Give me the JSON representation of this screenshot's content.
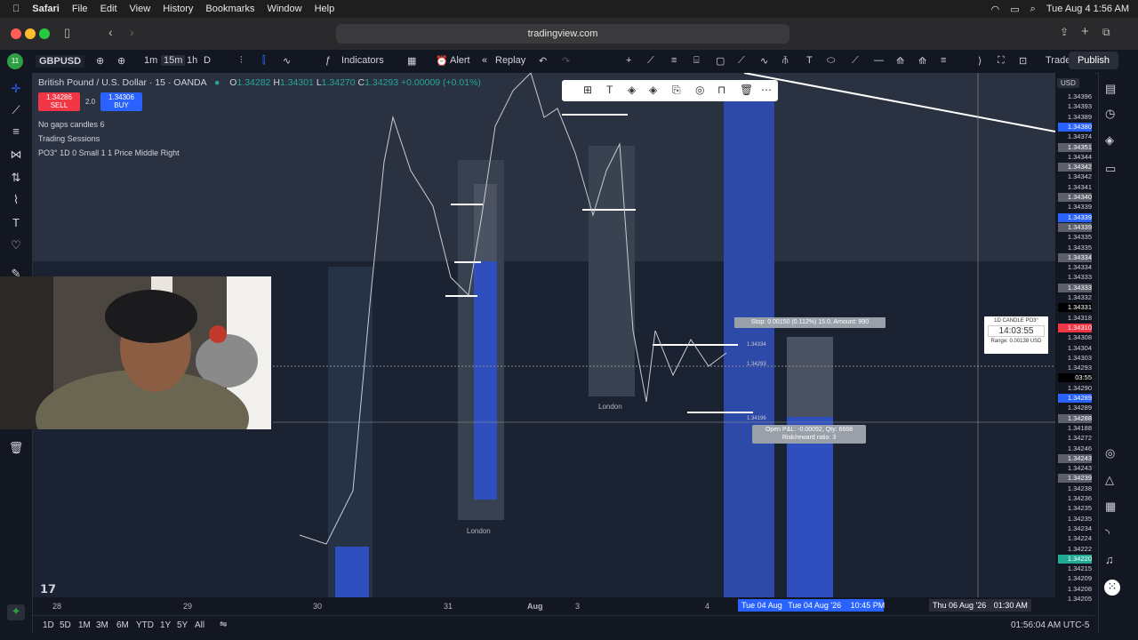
{
  "menubar": {
    "apple": "",
    "items": [
      "Safari",
      "File",
      "Edit",
      "View",
      "History",
      "Bookmarks",
      "Window",
      "Help"
    ],
    "clock": "Tue Aug 4  1:56 AM"
  },
  "browser": {
    "url": "tradingview.com"
  },
  "toolbar": {
    "badge": "11",
    "symbol": "GBPUSD",
    "intervals": [
      "1m",
      "15m",
      "1h",
      "D"
    ],
    "indicators": "Indicators",
    "alert": "Alert",
    "replay": "Replay",
    "trade": "Trade",
    "publish": "Publish"
  },
  "legend": {
    "title": "British Pound / U.S. Dollar · 15 · OANDA",
    "o_label": "O",
    "o": "1.34282",
    "h_label": "H",
    "h": "1.34301",
    "l_label": "L",
    "l": "1.34270",
    "c_label": "C",
    "c": "1.34293",
    "change": "+0.00009 (+0.01%)",
    "sell_price": "1.34286",
    "sell_label": "SELL",
    "spread": "2.0",
    "buy_price": "1.34306",
    "buy_label": "BUY",
    "indicators": [
      "No gaps candles 6",
      "Trading Sessions",
      "PO3° 1D 0 Small 1 1 Price Middle Right"
    ]
  },
  "chart": {
    "sessions": [
      "London",
      "London"
    ],
    "position": {
      "stop": "Stop: 0.00150 (0.112%) 15.0, Amount: 990",
      "pnl": "Open P&L: -0.00092, Qty: 6668",
      "rr": "Risk/reward ratio: 3",
      "entry": "1.34334",
      "entry2": "1.34293",
      "target": "1.34196"
    },
    "po3": {
      "title": "1D CANDLE PO3°",
      "timer": "14:03:55",
      "range": "Range: 0.00138 USD"
    }
  },
  "price_axis": {
    "currency": "USD",
    "prices": [
      "1.34396",
      "1.34393",
      "1.34389",
      "1.34380",
      "1.34374",
      "1.34351",
      "1.34344",
      "1.34342",
      "1.34342",
      "1.34341",
      "1.34340",
      "1.34339",
      "1.34339",
      "1.34339",
      "1.34335",
      "1.34335",
      "1.34334",
      "1.34334",
      "1.34333",
      "1.34333",
      "1.34332",
      "1.34331",
      "1.34318",
      "1.34310",
      "1.34308",
      "1.34304",
      "1.34303",
      "1.34293",
      "03:55",
      "1.34290",
      "1.34289",
      "1.34289",
      "1.34288",
      "1.34188",
      "1.34272",
      "1.34246",
      "1.34243",
      "1.34243",
      "1.34239",
      "1.34238",
      "1.34236",
      "1.34235",
      "1.34235",
      "1.34234",
      "1.34224",
      "1.34222",
      "1.34220",
      "1.34215",
      "1.34209",
      "1.34208",
      "1.34205"
    ],
    "highlight_colors": {
      "blue": "#2962ff",
      "red": "#f23645",
      "green": "#22ab94",
      "grey": "#5d606b",
      "black": "#000000"
    }
  },
  "time_axis": {
    "labels": [
      "28",
      "29",
      "30",
      "31",
      "Aug",
      "3",
      "4"
    ],
    "selected_range": "Tue 04 Aug",
    "selected_range2": "Tue 04 Aug '26",
    "selected_time": "10:45 PM",
    "crosshair": "Thu 06 Aug '26",
    "crosshair_time": "01:30 AM"
  },
  "bottom": {
    "ranges": [
      "1D",
      "5D",
      "1M",
      "3M",
      "6M",
      "YTD",
      "1Y",
      "5Y",
      "All"
    ],
    "clock": "01:56:04 AM UTC-5"
  },
  "colors": {
    "accent": "#2962ff",
    "bg": "#131722",
    "chart_bg": "#1b2232"
  }
}
